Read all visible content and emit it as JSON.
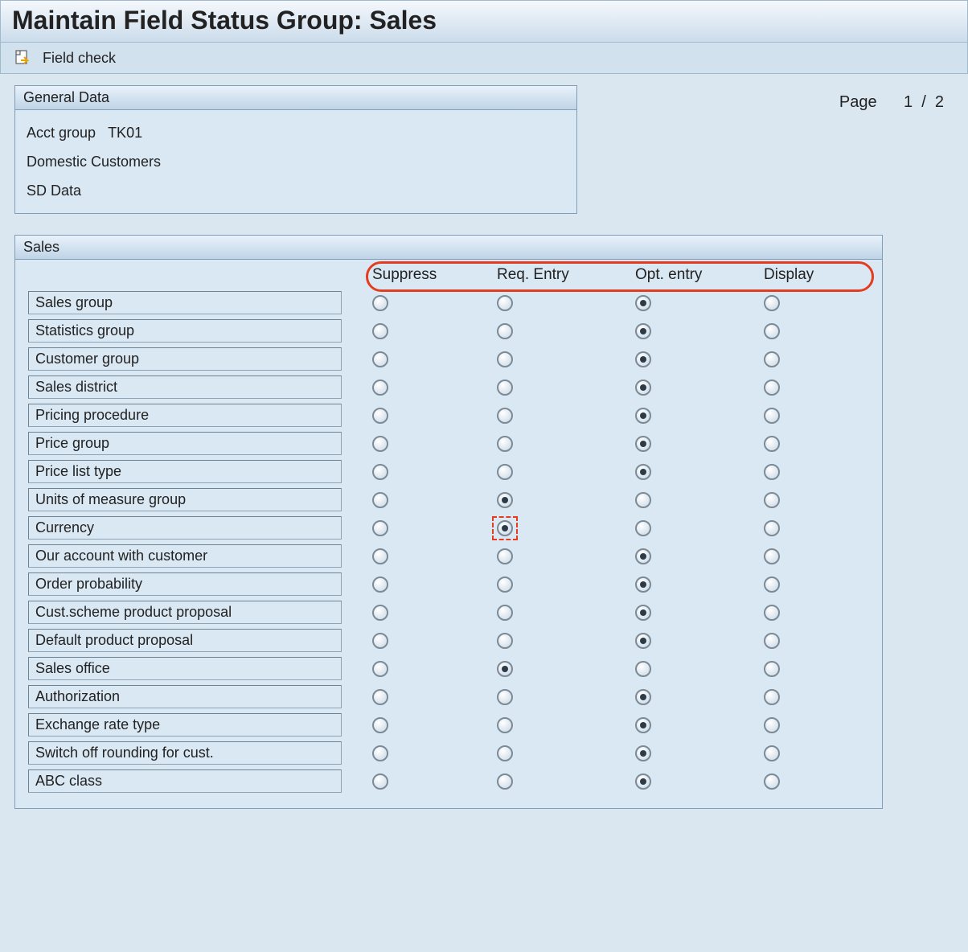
{
  "title": "Maintain Field Status Group: Sales",
  "toolbar": {
    "field_check_label": "Field check"
  },
  "general_panel": {
    "title": "General Data",
    "acct_group_label": "Acct group",
    "acct_group_value": "TK01",
    "customer_type": "Domestic Customers",
    "data_area": "SD Data"
  },
  "page_indicator": {
    "label": "Page",
    "current": "1",
    "sep": "/",
    "total": "2"
  },
  "sales_panel": {
    "title": "Sales",
    "columns": {
      "suppress": "Suppress",
      "req_entry": "Req. Entry",
      "opt_entry": "Opt. entry",
      "display": "Display"
    },
    "rows": [
      {
        "label": "Sales group",
        "selected": 2,
        "focused": false
      },
      {
        "label": "Statistics group",
        "selected": 2,
        "focused": false
      },
      {
        "label": "Customer group",
        "selected": 2,
        "focused": false
      },
      {
        "label": "Sales district",
        "selected": 2,
        "focused": false
      },
      {
        "label": "Pricing procedure",
        "selected": 2,
        "focused": false
      },
      {
        "label": "Price group",
        "selected": 2,
        "focused": false
      },
      {
        "label": "Price list type",
        "selected": 2,
        "focused": false
      },
      {
        "label": "Units of measure group",
        "selected": 1,
        "focused": false
      },
      {
        "label": "Currency",
        "selected": 1,
        "focused": true
      },
      {
        "label": "Our account with customer",
        "selected": 2,
        "focused": false
      },
      {
        "label": "Order probability",
        "selected": 2,
        "focused": false
      },
      {
        "label": "Cust.scheme product proposal",
        "selected": 2,
        "focused": false
      },
      {
        "label": "Default product proposal",
        "selected": 2,
        "focused": false
      },
      {
        "label": "Sales office",
        "selected": 1,
        "focused": false
      },
      {
        "label": "Authorization",
        "selected": 2,
        "focused": false
      },
      {
        "label": "Exchange rate type",
        "selected": 2,
        "focused": false
      },
      {
        "label": "Switch off rounding for cust.",
        "selected": 2,
        "focused": false
      },
      {
        "label": "ABC class",
        "selected": 2,
        "focused": false
      }
    ]
  }
}
